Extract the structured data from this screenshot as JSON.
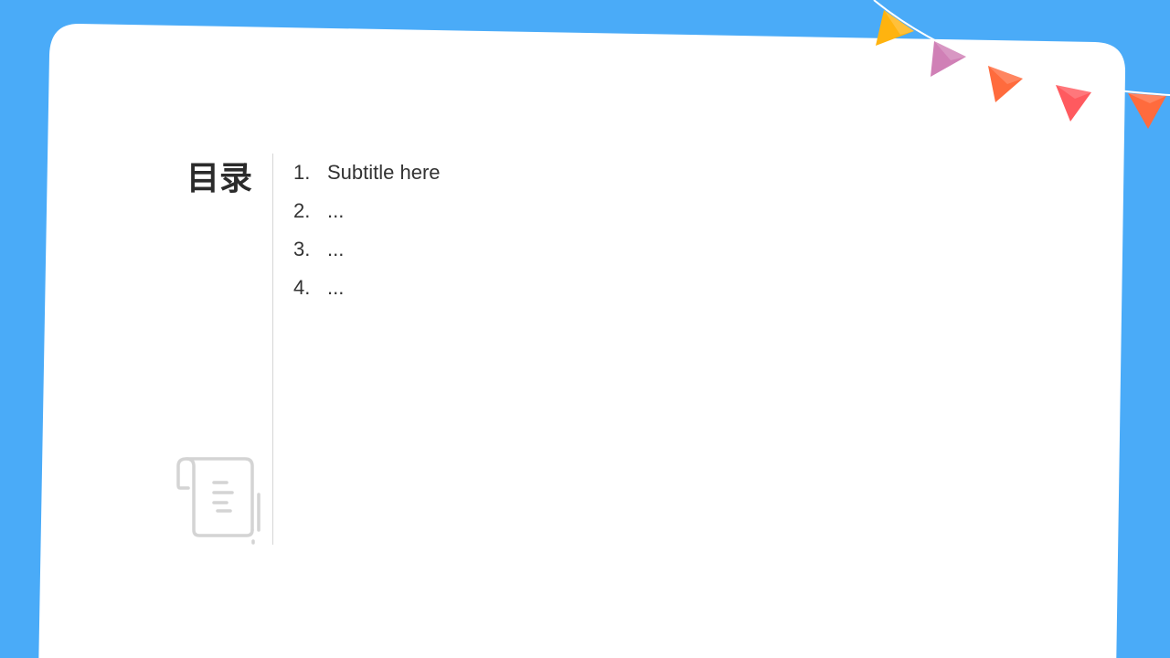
{
  "toc": {
    "title": "目录",
    "items": [
      {
        "number": "1.",
        "label": "Subtitle here"
      },
      {
        "number": "2.",
        "label": "..."
      },
      {
        "number": "3.",
        "label": "..."
      },
      {
        "number": "4.",
        "label": "..."
      }
    ]
  },
  "decor": {
    "icon": "scroll-document-icon",
    "bunting_colors": [
      "#FFB30F",
      "#D080B6",
      "#FF6B3D",
      "#FF5A5F",
      "#FF6B3D"
    ],
    "background_color": "#4AABF8",
    "card_color": "#FFFFFF"
  }
}
